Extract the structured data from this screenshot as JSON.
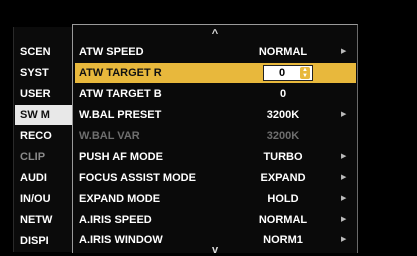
{
  "categories": [
    {
      "label": "SCEN",
      "state": "normal"
    },
    {
      "label": "SYST",
      "state": "normal"
    },
    {
      "label": "USER",
      "state": "normal"
    },
    {
      "label": "SW M",
      "state": "selected"
    },
    {
      "label": "RECO",
      "state": "normal"
    },
    {
      "label": "CLIP",
      "state": "dim"
    },
    {
      "label": "AUDI",
      "state": "normal"
    },
    {
      "label": "IN/OU",
      "state": "normal"
    },
    {
      "label": "NETW",
      "state": "normal"
    },
    {
      "label": "DISPI",
      "state": "normal"
    }
  ],
  "menu": {
    "scroll_up": "^",
    "scroll_down": "v",
    "items": [
      {
        "label": "ATW SPEED",
        "value": "NORMAL",
        "has_submenu": true,
        "dim": false
      },
      {
        "label": "ATW TARGET R",
        "value": "0",
        "has_submenu": false,
        "dim": false,
        "selected": true
      },
      {
        "label": "ATW TARGET B",
        "value": "0",
        "has_submenu": false,
        "dim": false
      },
      {
        "label": "W.BAL PRESET",
        "value": "3200K",
        "has_submenu": true,
        "dim": false
      },
      {
        "label": "W.BAL VAR",
        "value": "3200K",
        "has_submenu": false,
        "dim": true
      },
      {
        "label": "PUSH AF MODE",
        "value": "TURBO",
        "has_submenu": true,
        "dim": false
      },
      {
        "label": "FOCUS ASSIST MODE",
        "value": "EXPAND",
        "has_submenu": true,
        "dim": false
      },
      {
        "label": "EXPAND MODE",
        "value": "HOLD",
        "has_submenu": true,
        "dim": false
      },
      {
        "label": "A.IRIS SPEED",
        "value": "NORMAL",
        "has_submenu": true,
        "dim": false
      },
      {
        "label": "A.IRIS WINDOW",
        "value": "NORM1",
        "has_submenu": true,
        "dim": false
      }
    ]
  },
  "colors": {
    "highlight": "#e8b83c",
    "dim_text": "#6e6e6e"
  }
}
